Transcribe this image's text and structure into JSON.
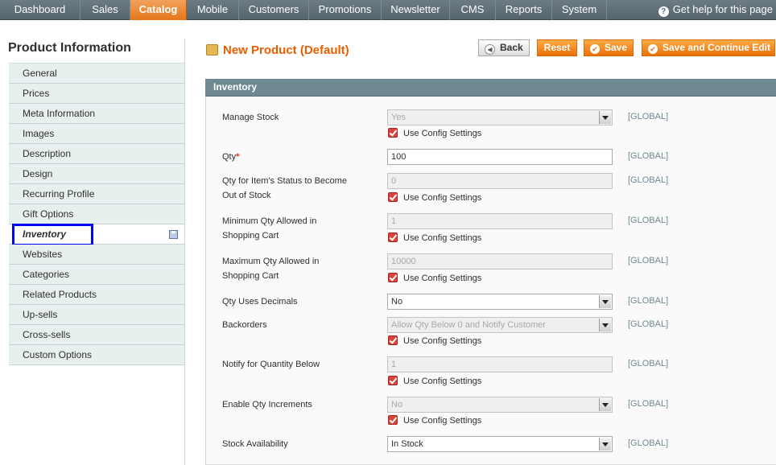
{
  "nav": {
    "items": [
      "Dashboard",
      "Sales",
      "Catalog",
      "Mobile",
      "Customers",
      "Promotions",
      "Newsletter",
      "CMS",
      "Reports",
      "System"
    ],
    "active": "Catalog",
    "help_label": "Get help for this page",
    "help_icon": "help-icon"
  },
  "sidebar": {
    "title": "Product Information",
    "items": [
      {
        "label": "General"
      },
      {
        "label": "Prices"
      },
      {
        "label": "Meta Information"
      },
      {
        "label": "Images"
      },
      {
        "label": "Description"
      },
      {
        "label": "Design"
      },
      {
        "label": "Recurring Profile"
      },
      {
        "label": "Gift Options"
      },
      {
        "label": "Inventory",
        "active": true
      },
      {
        "label": "Websites"
      },
      {
        "label": "Categories"
      },
      {
        "label": "Related Products"
      },
      {
        "label": "Up-sells"
      },
      {
        "label": "Cross-sells"
      },
      {
        "label": "Custom Options"
      }
    ]
  },
  "header": {
    "title": "New Product (Default)",
    "buttons": {
      "back": "Back",
      "reset": "Reset",
      "save": "Save",
      "save_continue": "Save and Continue Edit"
    }
  },
  "inventory": {
    "section_title": "Inventory",
    "scope_label": "[GLOBAL]",
    "use_config_label": "Use Config Settings",
    "fields": {
      "manage_stock": {
        "label": "Manage Stock",
        "value": "Yes"
      },
      "qty": {
        "label": "Qty",
        "required_mark": "*",
        "value": "100"
      },
      "min_qty": {
        "label_line1": "Qty for Item's Status to Become",
        "label_line2": "Out of Stock",
        "value": "0"
      },
      "min_sale_qty": {
        "label_line1": "Minimum Qty Allowed in",
        "label_line2": "Shopping Cart",
        "value": "1"
      },
      "max_sale_qty": {
        "label_line1": "Maximum Qty Allowed in",
        "label_line2": "Shopping Cart",
        "value": "10000"
      },
      "is_qty_decimal": {
        "label": "Qty Uses Decimals",
        "value": "No"
      },
      "backorders": {
        "label": "Backorders",
        "value": "Allow Qty Below 0 and Notify Customer"
      },
      "notify_stock_qty": {
        "label": "Notify for Quantity Below",
        "value": "1"
      },
      "enable_qty_increments": {
        "label": "Enable Qty Increments",
        "value": "No"
      },
      "stock_availability": {
        "label": "Stock Availability",
        "value": "In Stock"
      }
    }
  },
  "colors": {
    "accent": "#eb5e00",
    "nav_bg": "#5f6e76",
    "section_head": "#6f8992",
    "checkbox": "#d9453b",
    "highlight_box": "#0000ff"
  }
}
